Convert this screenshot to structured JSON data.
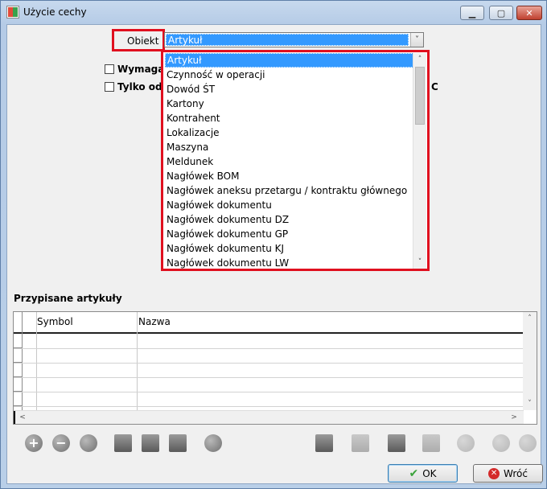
{
  "window": {
    "title": "Użycie cechy",
    "min_glyph": "▁",
    "max_glyph": "▢",
    "close_glyph": "✕"
  },
  "object_selector": {
    "label": "Obiekt",
    "selected": "Artykuł",
    "arrow": "˅"
  },
  "checkboxes": {
    "required": "Wymaga",
    "only": "Tylko odo",
    "trailing_fragment": "C"
  },
  "dropdown": {
    "items": [
      "Artykuł",
      "Czynność w operacji",
      "Dowód ŚT",
      "Kartony",
      "Kontrahent",
      "Lokalizacje",
      "Maszyna",
      "Meldunek",
      "Nagłówek BOM",
      "Nagłówek aneksu przetargu / kontraktu głównego",
      "Nagłówek dokumentu",
      "Nagłówek dokumentu DZ",
      "Nagłówek dokumentu GP",
      "Nagłówek dokumentu KJ",
      "Nagłówek dokumentu LW"
    ],
    "selected_index": 0,
    "scroll_up": "˄",
    "scroll_down": "˅"
  },
  "assigned": {
    "title": "Przypisane artykuły",
    "columns": [
      "Symbol",
      "Nazwa"
    ],
    "scroll_up": "˄",
    "scroll_down": "˅",
    "scroll_left": "<",
    "scroll_right": ">"
  },
  "toolbar": {
    "icons": [
      "add-icon",
      "remove-icon",
      "edit-icon",
      "binoculars-icon",
      "grid-icon",
      "sum-icon",
      "settings-icon",
      "report-icon",
      "document-icon",
      "save-icon",
      "windows-icon",
      "refresh-icon",
      "first-icon",
      "last-icon"
    ],
    "add_glyph": "+",
    "remove_glyph": "−"
  },
  "buttons": {
    "ok": "OK",
    "ok_glyph": "✔",
    "back": "Wróć",
    "back_glyph": "✕"
  }
}
